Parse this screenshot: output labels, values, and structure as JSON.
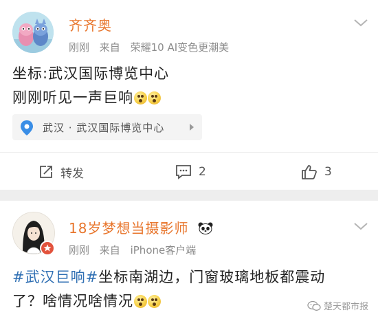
{
  "post1": {
    "username": "齐齐奥",
    "meta": {
      "time": "刚刚",
      "source_prefix": "来自",
      "source": "荣耀10 AI变色更潮美"
    },
    "body_line1": "坐标:武汉国际博览中心",
    "body_line2": "刚刚听见一声巨响",
    "location": "武汉 · 武汉国际博览中心",
    "actions": {
      "repost_label": "转发",
      "comments": "2",
      "likes": "3"
    }
  },
  "post2": {
    "username": "18岁梦想当摄影师",
    "badge_emoji": "🐼",
    "meta": {
      "time": "刚刚",
      "source_prefix": "来自",
      "source": "iPhone客户端"
    },
    "topic": "#武汉巨响#",
    "body_line1": "坐标南湖边，门窗玻璃地板都震动",
    "body_line2": "了？啥情况啥情况"
  },
  "watermark": "楚天都市报",
  "colors": {
    "username": "#e8762d",
    "topic": "#2f6fb3",
    "meta": "#8c8c8c",
    "background": "#eeeeee"
  }
}
